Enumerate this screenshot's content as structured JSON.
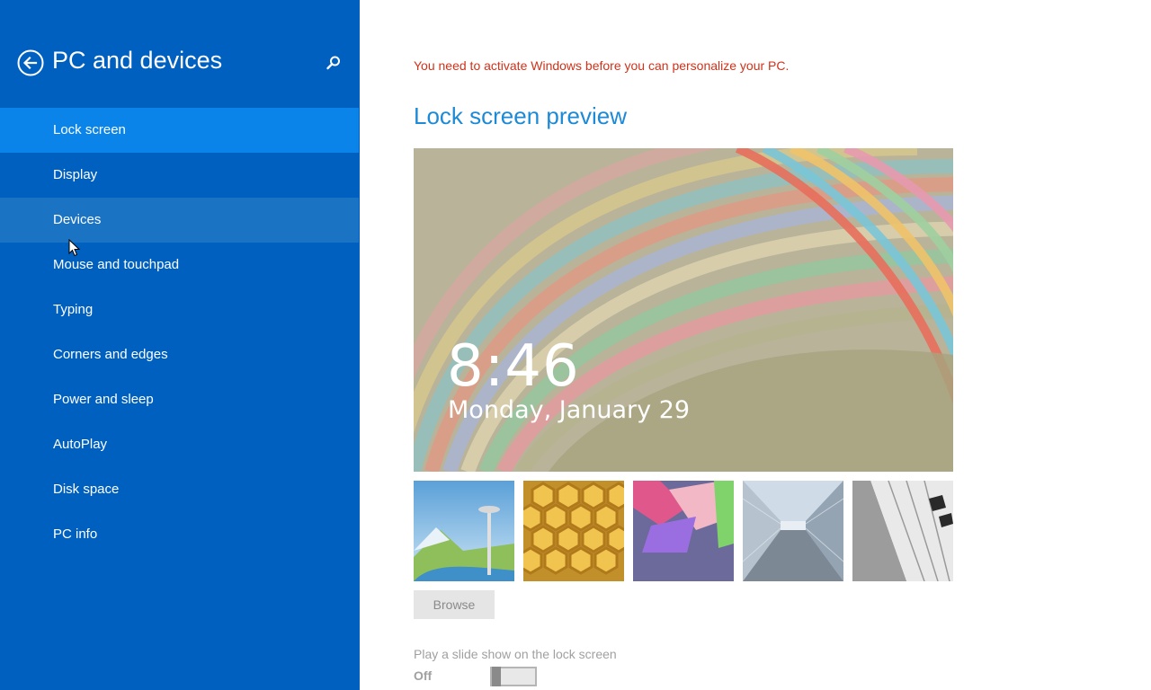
{
  "sidebar": {
    "title": "PC and devices",
    "back_icon": "back-arrow-circle-icon",
    "search_icon": "search-icon",
    "items": [
      {
        "label": "Lock screen",
        "state": "selected"
      },
      {
        "label": "Display",
        "state": ""
      },
      {
        "label": "Devices",
        "state": "hover"
      },
      {
        "label": "Mouse and touchpad",
        "state": ""
      },
      {
        "label": "Typing",
        "state": ""
      },
      {
        "label": "Corners and edges",
        "state": ""
      },
      {
        "label": "Power and sleep",
        "state": ""
      },
      {
        "label": "AutoPlay",
        "state": ""
      },
      {
        "label": "Disk space",
        "state": ""
      },
      {
        "label": "PC info",
        "state": ""
      }
    ]
  },
  "main": {
    "activation_warning": "You need to activate Windows before you can personalize your PC.",
    "section_title": "Lock screen preview",
    "preview": {
      "time": "8:46",
      "date": "Monday, January 29"
    },
    "thumbnails": [
      {
        "name": "thumbnail-space-needle"
      },
      {
        "name": "thumbnail-honeycomb"
      },
      {
        "name": "thumbnail-geometric"
      },
      {
        "name": "thumbnail-tunnel"
      },
      {
        "name": "thumbnail-piano"
      }
    ],
    "browse_label": "Browse",
    "slideshow_label": "Play a slide show on the lock screen",
    "slideshow_state": "Off"
  },
  "colors": {
    "sidebar_bg": "#0060c0",
    "selected_bg": "#0a84e8",
    "hover_bg": "#1b73c4",
    "warning": "#d0321a",
    "accent": "#1c8ad6"
  }
}
